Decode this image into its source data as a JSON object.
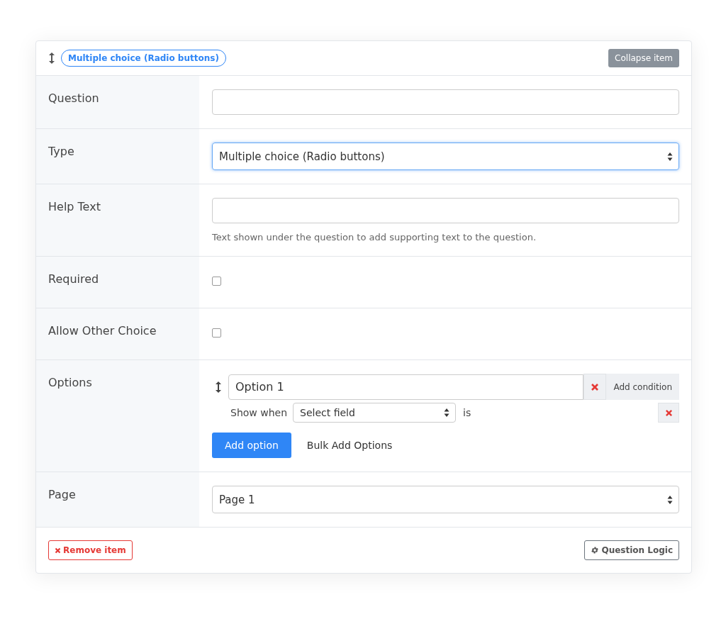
{
  "header": {
    "type_badge": "Multiple choice (Radio buttons)",
    "collapse_button": "Collapse item"
  },
  "rows": [
    {
      "kind": "text",
      "label": "Question"
    },
    {
      "kind": "select",
      "label": "Type",
      "value": "Multiple choice (Radio buttons)",
      "focused": true
    },
    {
      "kind": "text",
      "label": "Help Text",
      "help": "Text shown under the question to add supporting text to the question."
    },
    {
      "kind": "checkbox",
      "label": "Required",
      "checked": false
    },
    {
      "kind": "checkbox",
      "label": "Allow Other Choice",
      "checked": false
    },
    {
      "kind": "options",
      "label": "Options",
      "options": [
        {
          "value": "Option 1",
          "condition_button": "Add condition",
          "show_when": "Show when",
          "field_select": "Select field",
          "operator": "is"
        }
      ],
      "add_button": "Add option",
      "bulk_link": "Bulk Add Options"
    },
    {
      "kind": "select",
      "label": "Page",
      "value": "Page 1",
      "focused": false
    }
  ],
  "footer": {
    "remove_button": "Remove item",
    "logic_button": "Question Logic"
  }
}
